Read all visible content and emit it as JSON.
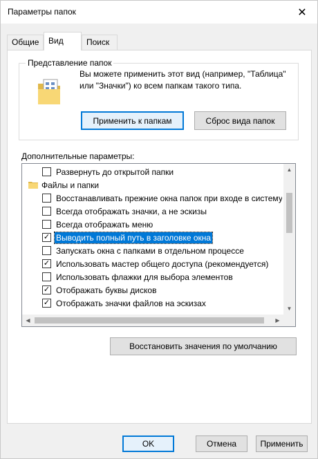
{
  "window": {
    "title": "Параметры папок",
    "close_glyph": "✕"
  },
  "tabs": [
    {
      "label": "Общие"
    },
    {
      "label": "Вид"
    },
    {
      "label": "Поиск"
    }
  ],
  "folder_views": {
    "legend": "Представление папок",
    "description": "Вы можете применить этот вид (например, \"Таблица\" или \"Значки\") ко всем папкам такого типа.",
    "apply_button": "Применить к папкам",
    "reset_button": "Сброс вида папок"
  },
  "advanced": {
    "label": "Дополнительные параметры:",
    "items": [
      {
        "type": "checkbox",
        "checked": false,
        "text": "Развернуть до открытой папки"
      },
      {
        "type": "folder",
        "text": "Файлы и папки"
      },
      {
        "type": "checkbox",
        "checked": false,
        "text": "Восстанавливать прежние окна папок при входе в систему"
      },
      {
        "type": "checkbox",
        "checked": false,
        "text": "Всегда отображать значки, а не эскизы"
      },
      {
        "type": "checkbox",
        "checked": false,
        "text": "Всегда отображать меню"
      },
      {
        "type": "checkbox",
        "checked": true,
        "selected": true,
        "text": "Выводить полный путь в заголовке окна"
      },
      {
        "type": "checkbox",
        "checked": false,
        "text": "Запускать окна с папками в отдельном процессе"
      },
      {
        "type": "checkbox",
        "checked": true,
        "text": "Использовать мастер общего доступа (рекомендуется)"
      },
      {
        "type": "checkbox",
        "checked": false,
        "text": "Использовать флажки для выбора элементов"
      },
      {
        "type": "checkbox",
        "checked": true,
        "text": "Отображать буквы дисков"
      },
      {
        "type": "checkbox",
        "checked": true,
        "text": "Отображать значки файлов на эскизах"
      }
    ],
    "check_glyph": "✓",
    "restore_button": "Восстановить значения по умолчанию"
  },
  "footer": {
    "ok": "OK",
    "cancel": "Отмена",
    "apply": "Применить"
  },
  "colors": {
    "accent": "#0078d7",
    "folder": "#f8d775",
    "folder_dark": "#e0b84a"
  }
}
